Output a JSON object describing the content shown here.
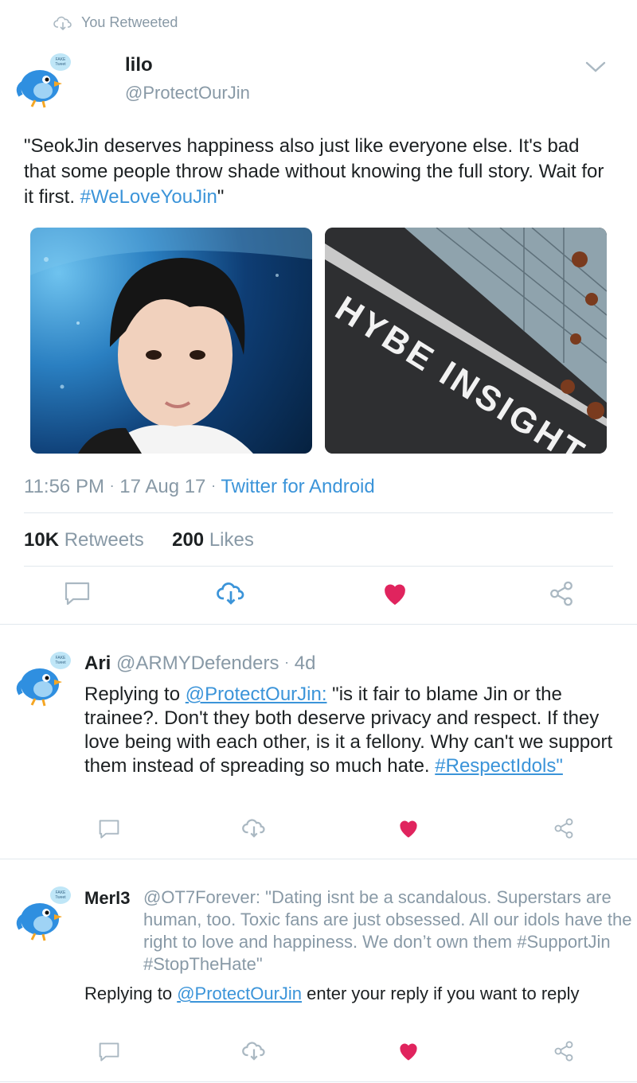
{
  "retweet_context": {
    "label": "You Retweeted"
  },
  "main_tweet": {
    "display_name": "lilo",
    "handle": "@ProtectOurJin",
    "avatar_badge": "FAKE Tweet",
    "text_pre": "\"SeokJin deserves happiness also just like everyone else. It's bad that some people throw shade without knowing the full story. Wait for it first. ",
    "hashtag": "#WeLoveYouJin",
    "text_post": "\"",
    "image2_sign": "HYBE INSIGHT",
    "time": "11:56 PM",
    "sep": "·",
    "date": "17 Aug 17",
    "source": "Twitter for Android",
    "retweets_count": "10K",
    "retweets_label": "Retweets",
    "likes_count": "200",
    "likes_label": "Likes"
  },
  "replies": [
    {
      "display_name": "Ari",
      "handle": "@ARMYDefenders",
      "sep": "·",
      "time": "4d",
      "replying_label": "Replying to",
      "replying_handle": "@ProtectOurJin:",
      "text": "\"is it fair to blame Jin or the trainee?. Don't they both deserve privacy and respect. If they love being with each other, is it a fellony. Why can't we support them instead of spreading so much hate.",
      "hashtag": "#RespectIdols\""
    },
    {
      "display_name": "Merl3",
      "quote": "@OT7Forever: \"Dating isnt be a scandalous. Superstars are human, too. Toxic fans are just obsessed. All our idols have the right to love and happiness. We don’t own them #SupportJin #StopTheHate\"",
      "replying_label": "Replying to",
      "replying_handle": "@ProtectOurJin",
      "reply_text": "enter your reply if you want to reply"
    }
  ],
  "colors": {
    "accent": "#3b94d9",
    "like": "#e0245e",
    "icon_gray": "#aab8c2"
  },
  "icons": [
    "retweet-icon",
    "chevron-down-icon",
    "reply-icon",
    "like-icon",
    "share-icon"
  ]
}
